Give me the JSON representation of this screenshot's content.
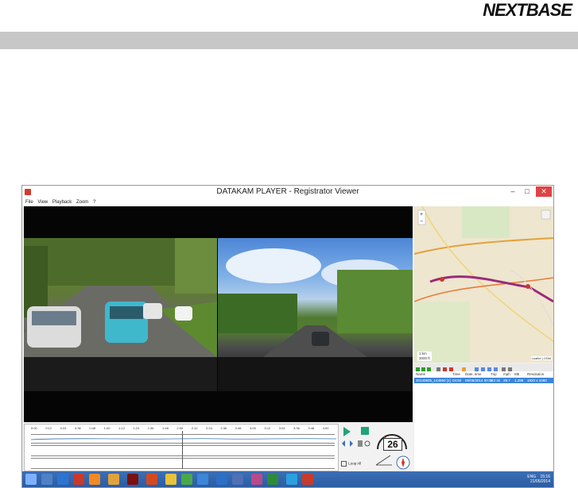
{
  "brand": {
    "text": "NEXTBASE"
  },
  "window": {
    "title": "DATAKAM PLAYER - Registrator Viewer",
    "controls": {
      "minimize": "–",
      "maximize": "□",
      "close": "✕"
    }
  },
  "menu": [
    "File",
    "View",
    "Playback",
    "Zoom",
    "?"
  ],
  "map": {
    "scale_km": "1 km",
    "scale_ft": "3000 ft",
    "attribution": "Leaflet | OSM"
  },
  "track_table": {
    "headers": [
      "Name",
      "Time",
      "Date, time",
      "Trip",
      "mph",
      "Mb",
      "Resolution"
    ],
    "rows": [
      [
        "20140605_144550 [1]",
        "04:50",
        "05/06/2014 00:00",
        "2.2 mi",
        "29.7",
        "1,298",
        "1920 x 1080"
      ]
    ]
  },
  "timeline": {
    "ticks": [
      "0:00",
      "0:12",
      "0:24",
      "0:36",
      "0:48",
      "1:00",
      "1:12",
      "1:24",
      "1:36",
      "1:48",
      "2:00",
      "2:12",
      "2:24",
      "2:36",
      "2:48",
      "3:00",
      "3:12",
      "3:24",
      "3:36",
      "3:48",
      "4:00"
    ]
  },
  "speed": {
    "value": "26"
  },
  "loop": {
    "label": "Loop All"
  },
  "tray": {
    "time": "15:16",
    "date": "21/05/2014",
    "lang": "ENG"
  },
  "colors": {
    "accent": "#1fa37a",
    "close": "#e04343",
    "taskbar": "#2b5a9f",
    "route": "#9b2a7a"
  }
}
